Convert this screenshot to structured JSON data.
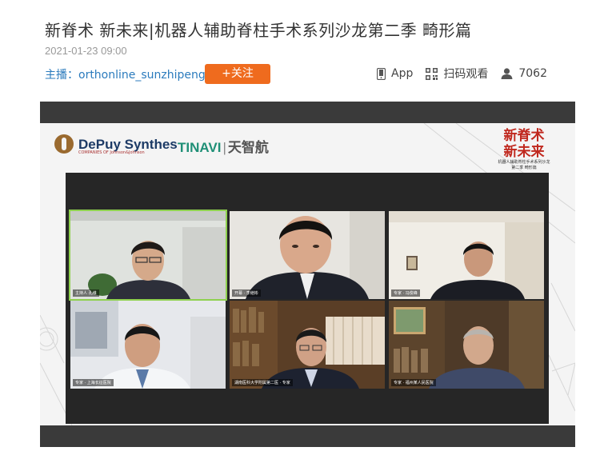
{
  "article": {
    "title": "新脊术 新未来|机器人辅助脊柱手术系列沙龙第二季 畸形篇",
    "date": "2021-01-23 09:00",
    "host_label": "主播：orthonline_sunzhipeng",
    "follow_label": "+关注"
  },
  "stats": {
    "app_label": "App",
    "scan_label": "扫码观看",
    "view_count": "7062"
  },
  "slide": {
    "sponsor1_name": "DePuy Synthes",
    "sponsor1_sub": "COMPANIES OF Johnson&Johnson",
    "sponsor2_name": "TINAVI",
    "sponsor2_sep": "|",
    "sponsor2_cn": "天智航",
    "brand_line1": "新脊术",
    "brand_line2": "新未来",
    "brand_small1": "机器人辅助脊柱手术系列沙龙",
    "brand_small2": "第二季 畸形篇"
  },
  "participants": [
    {
      "caption": "主持人 孔维",
      "active": true
    },
    {
      "caption": "开幕 · 李继彬",
      "active": false
    },
    {
      "caption": "专家 · 冯俊峰",
      "active": false
    },
    {
      "caption": "专家 · 上海长征医院",
      "active": false
    },
    {
      "caption": "湖南医科大学附属第二医 · 专家",
      "active": false
    },
    {
      "caption": "专家 · 福州某人民医院",
      "active": false
    }
  ],
  "colors": {
    "follow_bg": "#ef6b1e",
    "host_link": "#2b7bbd",
    "brand_red": "#c0281e",
    "active_tile": "#8fd14f"
  }
}
